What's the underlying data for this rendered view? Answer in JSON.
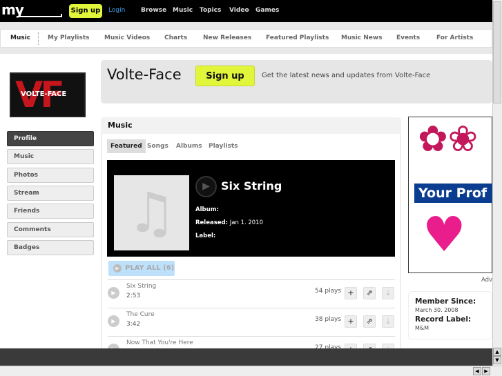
{
  "topbar": {
    "logo": "my",
    "signup": "Sign up",
    "login": "Login",
    "nav": [
      "Browse",
      "Music",
      "Topics",
      "Video",
      "Games"
    ]
  },
  "subnav": [
    "Music",
    "My Playlists",
    "Music Videos",
    "Charts",
    "New Releases",
    "Featured Playlists",
    "Music News",
    "Events",
    "For Artists"
  ],
  "artist": {
    "logo_text": "VOLTE-FACE",
    "name": "Volte-Face",
    "signup": "Sign up",
    "tagline": "Get the latest news and updates from Volte-Face"
  },
  "sidebar": [
    "Profile",
    "Music",
    "Photos",
    "Stream",
    "Friends",
    "Comments",
    "Badges"
  ],
  "music": {
    "title": "Music",
    "tabs": [
      "Featured",
      "Songs",
      "Albums",
      "Playlists"
    ],
    "featured": {
      "label": "",
      "title": "Six String",
      "album_label": "Album:",
      "album": "",
      "released_label": "Released:",
      "released": "Jan 1. 2010",
      "label_label": "Label:"
    },
    "play_all": "PLAY ALL (6)",
    "songs": [
      {
        "name": "Six String",
        "time": "2:53",
        "plays": "54 plays"
      },
      {
        "name": "The Cure",
        "time": "3:42",
        "plays": "38 plays"
      },
      {
        "name": "Now That You're Here",
        "time": "",
        "plays": "27 plays"
      }
    ]
  },
  "ad": {
    "text": "Your Prof",
    "caption": "Adv"
  },
  "member": {
    "since_label": "Member Since:",
    "since": "March 30. 2008",
    "label_label": "Record Label:",
    "label": "M&M"
  }
}
